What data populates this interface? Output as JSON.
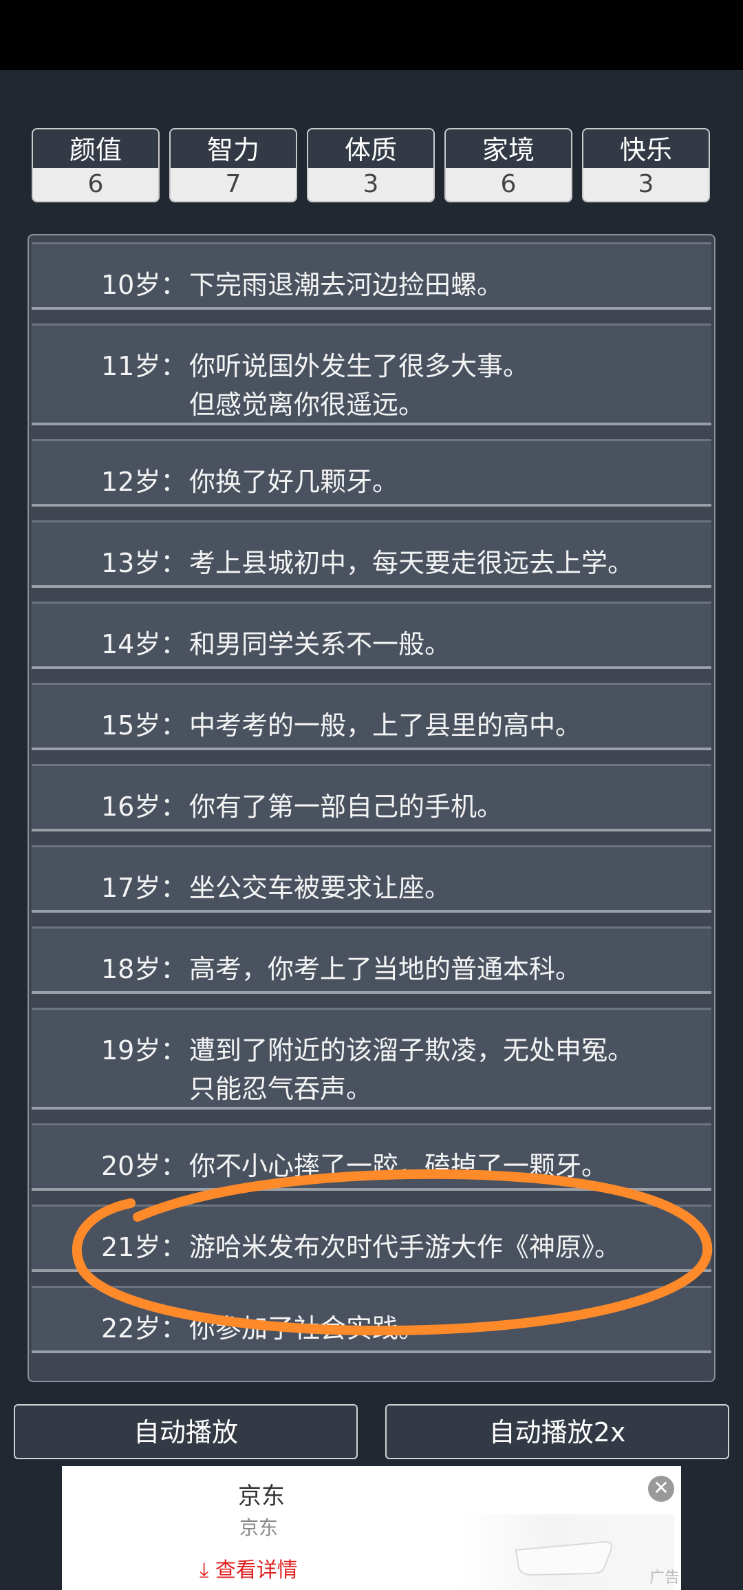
{
  "stats": [
    {
      "name": "颜值",
      "value": "6"
    },
    {
      "name": "智力",
      "value": "7"
    },
    {
      "name": "体质",
      "value": "3"
    },
    {
      "name": "家境",
      "value": "6"
    },
    {
      "name": "快乐",
      "value": "3"
    }
  ],
  "events": [
    {
      "age": "10岁：",
      "lines": [
        "下完雨退潮去河边捡田螺。"
      ]
    },
    {
      "age": "11岁：",
      "lines": [
        "你听说国外发生了很多大事。",
        "但感觉离你很遥远。"
      ]
    },
    {
      "age": "12岁：",
      "lines": [
        "你换了好几颗牙。"
      ]
    },
    {
      "age": "13岁：",
      "lines": [
        "考上县城初中，每天要走很远去上学。"
      ]
    },
    {
      "age": "14岁：",
      "lines": [
        "和男同学关系不一般。"
      ]
    },
    {
      "age": "15岁：",
      "lines": [
        "中考考的一般，上了县里的高中。"
      ]
    },
    {
      "age": "16岁：",
      "lines": [
        "你有了第一部自己的手机。"
      ]
    },
    {
      "age": "17岁：",
      "lines": [
        "坐公交车被要求让座。"
      ]
    },
    {
      "age": "18岁：",
      "lines": [
        "高考，你考上了当地的普通本科。"
      ]
    },
    {
      "age": "19岁：",
      "lines": [
        "遭到了附近的该溜子欺凌，无处申冤。",
        "只能忍气吞声。"
      ]
    },
    {
      "age": "20岁：",
      "lines": [
        "你不小心摔了一跤，磕掉了一颗牙。"
      ]
    },
    {
      "age": "21岁：",
      "lines": [
        "游哈米发布次时代手游大作《神原》。"
      ]
    },
    {
      "age": "22岁：",
      "lines": [
        "你参加了社会实践。"
      ]
    }
  ],
  "buttons": {
    "auto_play": "自动播放",
    "auto_play_2x": "自动播放2x"
  },
  "ad": {
    "title": "京东",
    "subtitle": "京东",
    "cta": "查看详情",
    "label": "广告"
  },
  "colors": {
    "background": "#222831",
    "annotation": "#ff8a2a"
  }
}
